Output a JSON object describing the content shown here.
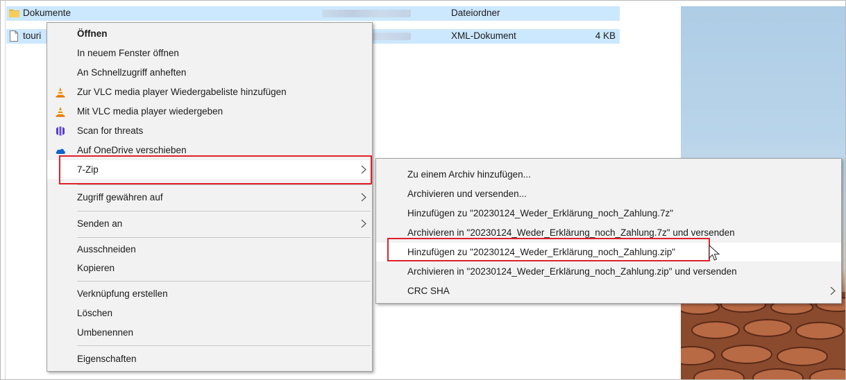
{
  "explorer": {
    "files": [
      {
        "name": "Dokumente",
        "type": "Dateiordner",
        "size": "",
        "icon": "folder-icon"
      },
      {
        "name": "touri",
        "type": "XML-Dokument",
        "size": "4 KB",
        "icon": "document-icon"
      }
    ]
  },
  "context_menu": {
    "items": [
      {
        "label": "Öffnen",
        "bold": true,
        "icon": ""
      },
      {
        "label": "In neuem Fenster öffnen",
        "icon": ""
      },
      {
        "label": "An Schnellzugriff anheften",
        "icon": ""
      },
      {
        "label": "Zur VLC media player Wiedergabeliste hinzufügen",
        "icon": "vlc-cone-icon"
      },
      {
        "label": "Mit VLC media player wiedergeben",
        "icon": "vlc-cone-icon"
      },
      {
        "label": "Scan for threats",
        "icon": "malwarebytes-icon"
      },
      {
        "label": "Auf OneDrive verschieben",
        "icon": "onedrive-cloud-icon"
      },
      {
        "label": "7-Zip",
        "submenu": true
      },
      {
        "label": "Zugriff gewähren auf",
        "submenu": true
      },
      {
        "label": "Senden an",
        "submenu": true
      },
      {
        "label": "Ausschneiden"
      },
      {
        "label": "Kopieren"
      },
      {
        "label": "Verknüpfung erstellen"
      },
      {
        "label": "Löschen"
      },
      {
        "label": "Umbenennen"
      },
      {
        "label": "Eigenschaften"
      }
    ]
  },
  "submenu_7zip": {
    "items": [
      {
        "label": "Zu einem Archiv hinzufügen..."
      },
      {
        "label": "Archivieren und versenden..."
      },
      {
        "label": "Hinzufügen zu \"20230124_Weder_Erklärung_noch_Zahlung.7z\""
      },
      {
        "label": "Archivieren in \"20230124_Weder_Erklärung_noch_Zahlung.7z\" und versenden"
      },
      {
        "label": "Hinzufügen zu \"20230124_Weder_Erklärung_noch_Zahlung.zip\"",
        "hovered": true
      },
      {
        "label": "Archivieren in \"20230124_Weder_Erklärung_noch_Zahlung.zip\" und versenden"
      },
      {
        "label": "CRC SHA",
        "submenu": true
      }
    ]
  },
  "colors": {
    "selection": "#cce8ff",
    "highlight_box": "#e0202a",
    "menu_bg": "#f2f2f2",
    "vlc_orange": "#f08a00",
    "onedrive_blue": "#0a64d2",
    "malwarebytes_purple": "#5b3fc8"
  }
}
